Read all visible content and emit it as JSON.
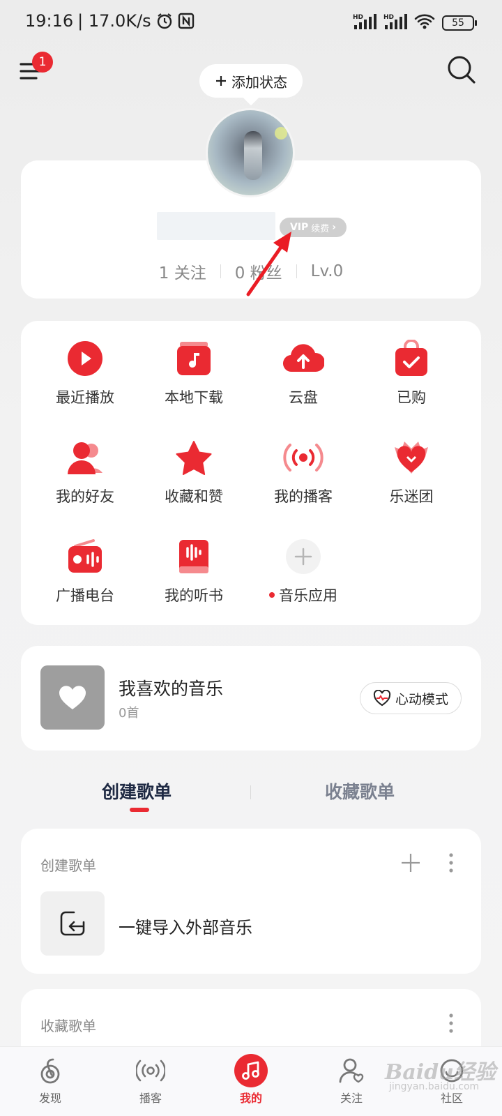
{
  "status_bar": {
    "time": "19:16",
    "speed": "| 17.0K/s",
    "signal_1": "HD",
    "signal_2": "HD",
    "battery": "55"
  },
  "header": {
    "menu_badge": "1",
    "status_button": "添加状态"
  },
  "profile": {
    "vip_label": "VIP",
    "vip_renew": "续费",
    "follows": "1 关注",
    "fans": "0 粉丝",
    "level": "Lv.0"
  },
  "shortcuts": [
    {
      "label": "最近播放",
      "icon": "play-icon"
    },
    {
      "label": "本地下载",
      "icon": "local-download-icon"
    },
    {
      "label": "云盘",
      "icon": "cloud-upload-icon"
    },
    {
      "label": "已购",
      "icon": "purchased-bag-icon"
    },
    {
      "label": "我的好友",
      "icon": "friends-icon"
    },
    {
      "label": "收藏和赞",
      "icon": "star-icon"
    },
    {
      "label": "我的播客",
      "icon": "podcast-icon"
    },
    {
      "label": "乐迷团",
      "icon": "fan-club-icon"
    },
    {
      "label": "广播电台",
      "icon": "radio-icon"
    },
    {
      "label": "我的听书",
      "icon": "audiobook-icon"
    },
    {
      "label": "音乐应用",
      "icon": "add-app-icon"
    }
  ],
  "liked": {
    "title": "我喜欢的音乐",
    "count": "0首",
    "heart_mode": "心动模式"
  },
  "tabs": {
    "create": "创建歌单",
    "collect": "收藏歌单"
  },
  "created_playlists": {
    "header": "创建歌单",
    "import_label": "一键导入外部音乐"
  },
  "collected_playlists": {
    "header": "收藏歌单"
  },
  "bottom_nav": [
    {
      "label": "发现",
      "icon": "discover-icon"
    },
    {
      "label": "播客",
      "icon": "podcast-nav-icon"
    },
    {
      "label": "我的",
      "icon": "music-note-icon",
      "active": true
    },
    {
      "label": "关注",
      "icon": "follow-icon"
    },
    {
      "label": "社区",
      "icon": "community-icon"
    }
  ],
  "watermark": {
    "text": "Baidu经验",
    "sub": "jingyan.baidu.com"
  },
  "colors": {
    "accent": "#ea2a32",
    "background": "#f2f2f2",
    "card": "#ffffff"
  }
}
